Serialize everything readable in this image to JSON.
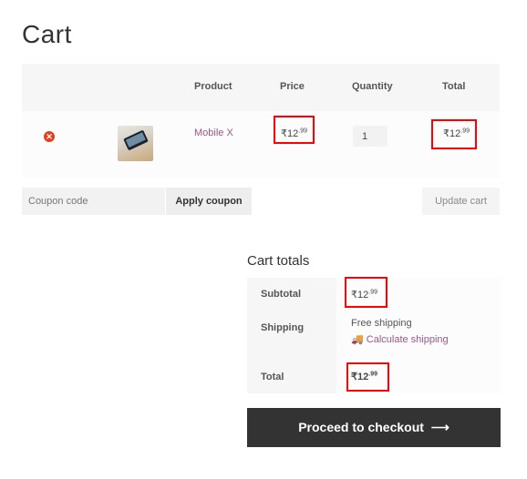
{
  "page": {
    "title": "Cart"
  },
  "cart_table": {
    "headers": [
      "",
      "",
      "Product",
      "Price",
      "Quantity",
      "Total"
    ],
    "rows": [
      {
        "remove_icon": "remove-circle-icon",
        "thumbnail": "mobile-phone-image",
        "product": "Mobile X",
        "price": {
          "currency": "₹",
          "whole": "12",
          "decimal": ".99"
        },
        "quantity": "1",
        "total": {
          "currency": "₹",
          "whole": "12",
          "decimal": ".99"
        }
      }
    ]
  },
  "actions": {
    "coupon_placeholder": "Coupon code",
    "apply_coupon": "Apply coupon",
    "update_cart": "Update cart"
  },
  "cart_totals": {
    "title": "Cart totals",
    "subtotal_label": "Subtotal",
    "subtotal": {
      "currency": "₹",
      "whole": "12",
      "decimal": ".99"
    },
    "shipping_label": "Shipping",
    "shipping_value": "Free shipping",
    "calculate_shipping": "Calculate shipping",
    "total_label": "Total",
    "total": {
      "currency": "₹",
      "whole": "12",
      "decimal": ".99"
    }
  },
  "checkout": {
    "label": "Proceed to checkout",
    "arrow": "⟶"
  },
  "colors": {
    "link": "#96588a",
    "remove": "#e2401c",
    "highlight": "#ff0000",
    "checkout_bg": "#333333"
  }
}
